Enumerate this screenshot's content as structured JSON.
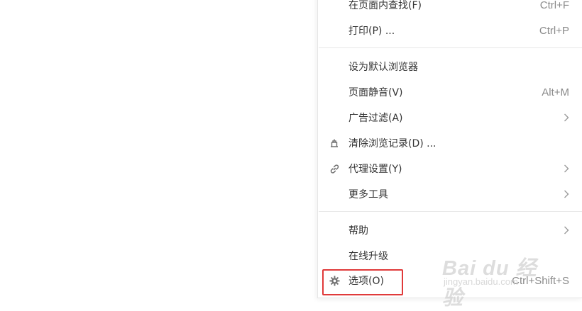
{
  "menu": {
    "items": [
      {
        "label": "在页面内查找(F)",
        "shortcut": "Ctrl+F"
      },
      {
        "label": "打印(P) ...",
        "shortcut": "Ctrl+P"
      },
      {
        "label": "设为默认浏览器"
      },
      {
        "label": "页面静音(V)",
        "shortcut": "Alt+M"
      },
      {
        "label": "广告过滤(A)",
        "submenu": true
      },
      {
        "label": "清除浏览记录(D) ...",
        "icon": "clear-history-icon"
      },
      {
        "label": "代理设置(Y)",
        "icon": "link-icon",
        "submenu": true
      },
      {
        "label": "更多工具",
        "submenu": true
      },
      {
        "label": "帮助",
        "submenu": true
      },
      {
        "label": "在线升级"
      },
      {
        "label": "选项(O)",
        "shortcut": "Ctrl+Shift+S",
        "icon": "gear-icon"
      }
    ]
  },
  "highlight_color": "#e03a3a",
  "watermark": {
    "logo_text": "Bai du 经验",
    "url": "jingyan.baidu.com"
  }
}
